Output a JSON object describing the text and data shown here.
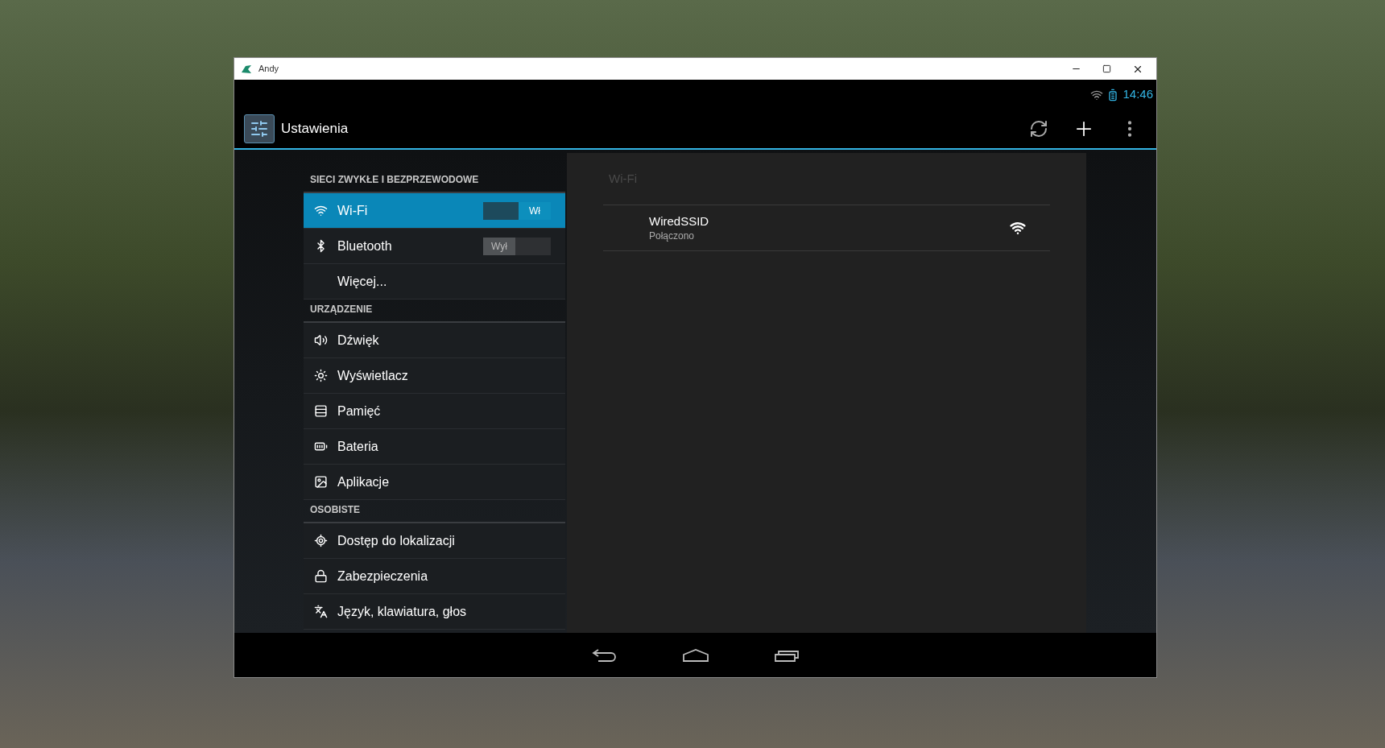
{
  "window": {
    "title": "Andy"
  },
  "status_bar": {
    "time": "14:46"
  },
  "action_bar": {
    "title": "Ustawienia"
  },
  "settings_sections": [
    {
      "header": "SIECI ZWYKŁE I BEZPRZEWODOWE",
      "items": [
        {
          "label": "Wi-Fi",
          "selected": true,
          "kind": "toggle",
          "toggle": {
            "on": true,
            "label": "Wł"
          }
        },
        {
          "label": "Bluetooth",
          "selected": false,
          "kind": "toggle",
          "toggle": {
            "on": false,
            "label": "Wył"
          }
        },
        {
          "label": "Więcej...",
          "selected": false,
          "kind": "plain"
        }
      ]
    },
    {
      "header": "URZĄDZENIE",
      "items": [
        {
          "label": "Dźwięk",
          "selected": false,
          "kind": "plain"
        },
        {
          "label": "Wyświetlacz",
          "selected": false,
          "kind": "plain"
        },
        {
          "label": "Pamięć",
          "selected": false,
          "kind": "plain"
        },
        {
          "label": "Bateria",
          "selected": false,
          "kind": "plain"
        },
        {
          "label": "Aplikacje",
          "selected": false,
          "kind": "plain"
        }
      ]
    },
    {
      "header": "OSOBISTE",
      "items": [
        {
          "label": "Dostęp do lokalizacji",
          "selected": false,
          "kind": "plain"
        },
        {
          "label": "Zabezpieczenia",
          "selected": false,
          "kind": "plain"
        },
        {
          "label": "Język, klawiatura, głos",
          "selected": false,
          "kind": "plain"
        }
      ]
    }
  ],
  "detail": {
    "title": "Wi-Fi",
    "networks": [
      {
        "ssid": "WiredSSID",
        "status": "Połączono"
      }
    ]
  }
}
